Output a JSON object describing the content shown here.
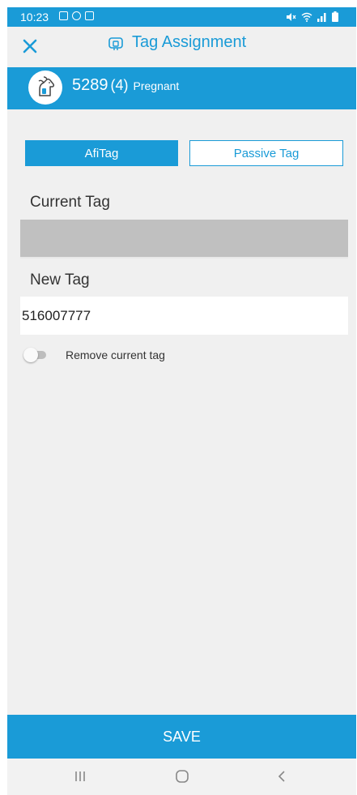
{
  "status_bar": {
    "time": "10:23"
  },
  "header": {
    "title": "Tag Assignment",
    "close_icon": "close-icon",
    "title_icon": "tag-icon"
  },
  "animal": {
    "number": "5289",
    "lactation": "(4)",
    "status": "Pregnant",
    "avatar_icon": "cow-icon"
  },
  "tabs": [
    {
      "label": "AfiTag",
      "selected": true
    },
    {
      "label": "Passive Tag",
      "selected": false
    }
  ],
  "fields": {
    "current_tag_label": "Current Tag",
    "current_tag_value": "",
    "new_tag_label": "New Tag",
    "new_tag_value": "516007777"
  },
  "remove_toggle": {
    "label": "Remove current tag",
    "on": false
  },
  "save_label": "SAVE",
  "colors": {
    "accent": "#1a9bd7",
    "background": "#f0f0f0",
    "disabled_field": "#c0c0c0"
  }
}
